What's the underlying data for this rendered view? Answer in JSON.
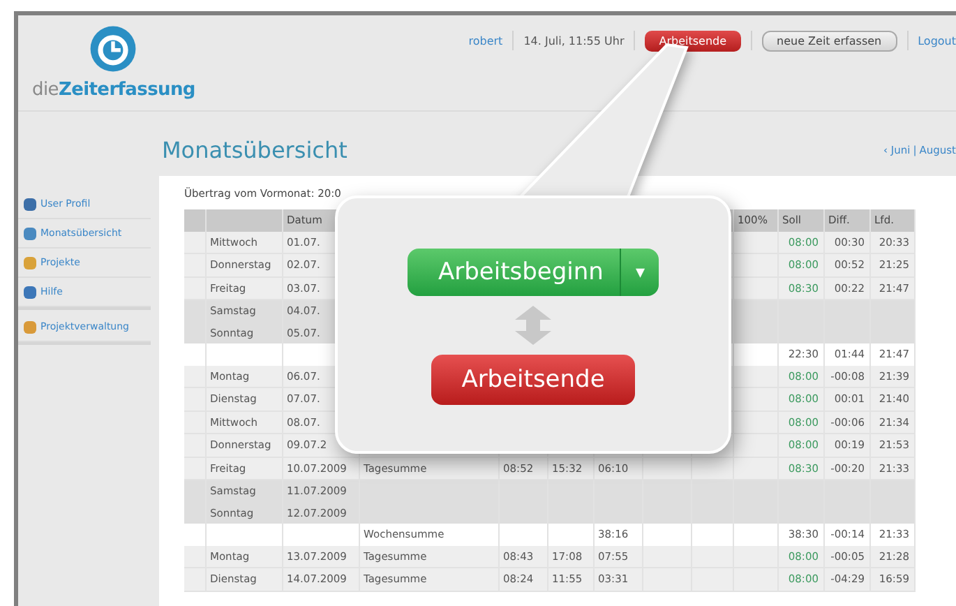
{
  "brand": {
    "prefix": "die",
    "name": "Zeiterfassung"
  },
  "topnav": {
    "user": "robert",
    "datetime": "14. Juli, 11:55 Uhr",
    "end_button": "Arbeitsende",
    "new_button": "neue Zeit erfassen",
    "logout": "Logout"
  },
  "page": {
    "title": "Monatsübersicht",
    "prev": "‹ Juni",
    "separator": "|",
    "next": "August"
  },
  "sidebar": {
    "items": [
      {
        "label": "User Profil"
      },
      {
        "label": "Monatsübersicht"
      },
      {
        "label": "Projekte"
      },
      {
        "label": "Hilfe"
      }
    ],
    "admin_items": [
      {
        "label": "Projektverwaltung"
      }
    ]
  },
  "summary": "Übertrag vom Vormonat: 20:0",
  "table": {
    "header": {
      "date": "Datum",
      "pct": "100%",
      "soll": "Soll",
      "diff": "Diff.",
      "total": "Lfd."
    },
    "rows": [
      {
        "kind": "weekday",
        "day": "Mittwoch",
        "date": "01.07.",
        "soll": "08:00",
        "diff": "00:30",
        "total": "20:33"
      },
      {
        "kind": "weekday",
        "day": "Donnerstag",
        "date": "02.07.",
        "soll": "08:00",
        "diff": "00:52",
        "total": "21:25"
      },
      {
        "kind": "weekday",
        "day": "Freitag",
        "date": "03.07.",
        "soll": "08:30",
        "diff": "00:22",
        "total": "21:47"
      },
      {
        "kind": "weekend",
        "day": "Samstag",
        "date": "04.07."
      },
      {
        "kind": "weekend",
        "day": "Sonntag",
        "date": "05.07."
      },
      {
        "kind": "week",
        "soll": "22:30",
        "diff": "01:44",
        "total": "21:47"
      },
      {
        "kind": "weekday",
        "day": "Montag",
        "date": "06.07.",
        "soll": "08:00",
        "diff": "-00:08",
        "total": "21:39"
      },
      {
        "kind": "weekday",
        "day": "Dienstag",
        "date": "07.07.",
        "soll": "08:00",
        "diff": "00:01",
        "total": "21:40"
      },
      {
        "kind": "weekday",
        "day": "Mittwoch",
        "date": "08.07.",
        "soll": "08:00",
        "diff": "-00:06",
        "total": "21:34"
      },
      {
        "kind": "weekday",
        "day": "Donnerstag",
        "date": "09.07.2",
        "soll": "08:00",
        "diff": "00:19",
        "total": "21:53"
      },
      {
        "kind": "weekday",
        "day": "Freitag",
        "date": "10.07.2009",
        "label": "Tagesumme",
        "begin": "08:52",
        "end": "15:32",
        "duration": "06:10",
        "soll": "08:30",
        "diff": "-00:20",
        "total": "21:33"
      },
      {
        "kind": "weekend",
        "day": "Samstag",
        "date": "11.07.2009"
      },
      {
        "kind": "weekend",
        "day": "Sonntag",
        "date": "12.07.2009"
      },
      {
        "kind": "week",
        "label": "Wochensumme",
        "duration": "38:16",
        "soll": "38:30",
        "diff": "-00:14",
        "total": "21:33"
      },
      {
        "kind": "weekday",
        "day": "Montag",
        "date": "13.07.2009",
        "label": "Tagesumme",
        "begin": "08:43",
        "end": "17:08",
        "duration": "07:55",
        "soll": "08:00",
        "diff": "-00:05",
        "total": "21:28"
      },
      {
        "kind": "weekday",
        "day": "Dienstag",
        "date": "14.07.2009",
        "label": "Tagesumme",
        "begin": "08:24",
        "end": "11:55",
        "duration": "03:31",
        "soll": "08:00",
        "diff": "-04:29",
        "total": "16:59"
      }
    ]
  },
  "popup": {
    "start_button": "Arbeitsbeginn",
    "start_caret": "▾",
    "end_button": "Arbeitsende"
  }
}
